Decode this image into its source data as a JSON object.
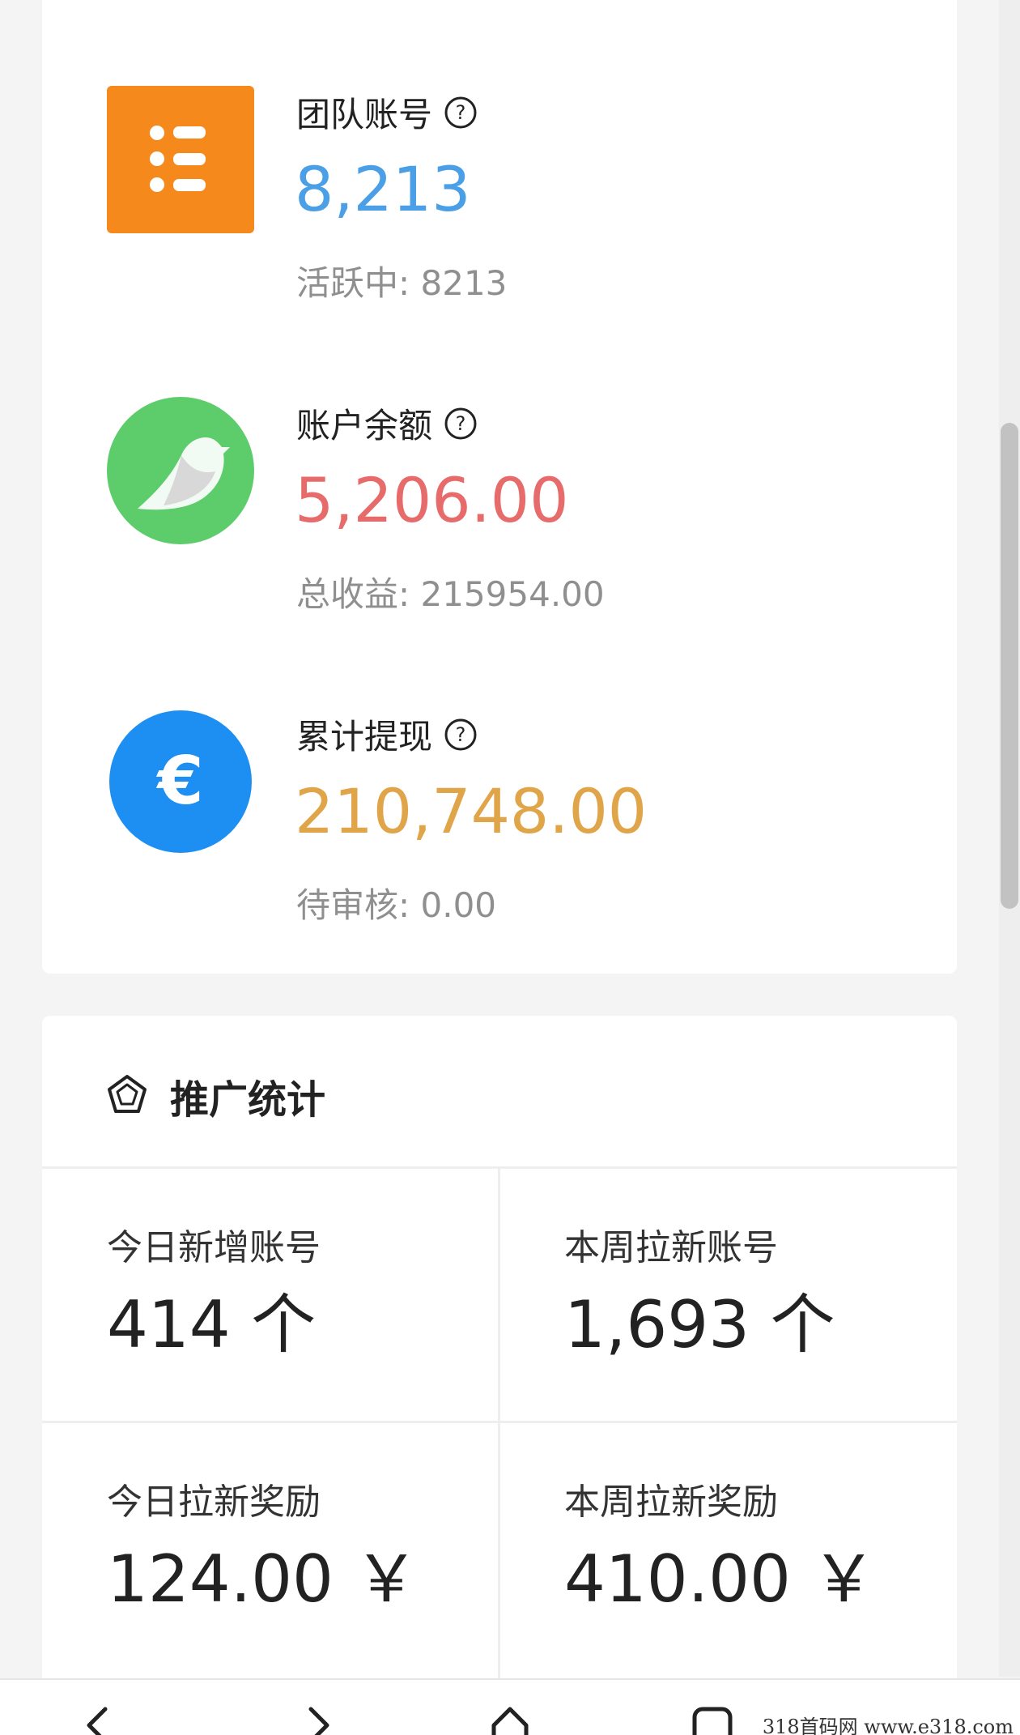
{
  "stats": [
    {
      "icon": "list-icon",
      "title": "团队账号",
      "value": "8,213",
      "value_color": "#4a9fe6",
      "sub": "活跃中: 8213"
    },
    {
      "icon": "bird-icon",
      "title": "账户余额",
      "value": "5,206.00",
      "value_color": "#e86b6b",
      "sub": "总收益: 215954.00"
    },
    {
      "icon": "euro-icon",
      "title": "累计提现",
      "value": "210,748.00",
      "value_color": "#e0a549",
      "sub": "待审核: 0.00"
    }
  ],
  "promo": {
    "title": "推广统计",
    "cells": [
      {
        "label": "今日新增账号",
        "value": "414 个"
      },
      {
        "label": "本周拉新账号",
        "value": "1,693 个"
      },
      {
        "label": "今日拉新奖励",
        "value": "124.00 ￥"
      },
      {
        "label": "本周拉新奖励",
        "value": "410.00 ￥"
      }
    ]
  },
  "watermark": "318首码网  www.e318.com",
  "colors": {
    "orange": "#f5891b",
    "green": "#5ccd6a",
    "blue": "#1e8ff2"
  }
}
